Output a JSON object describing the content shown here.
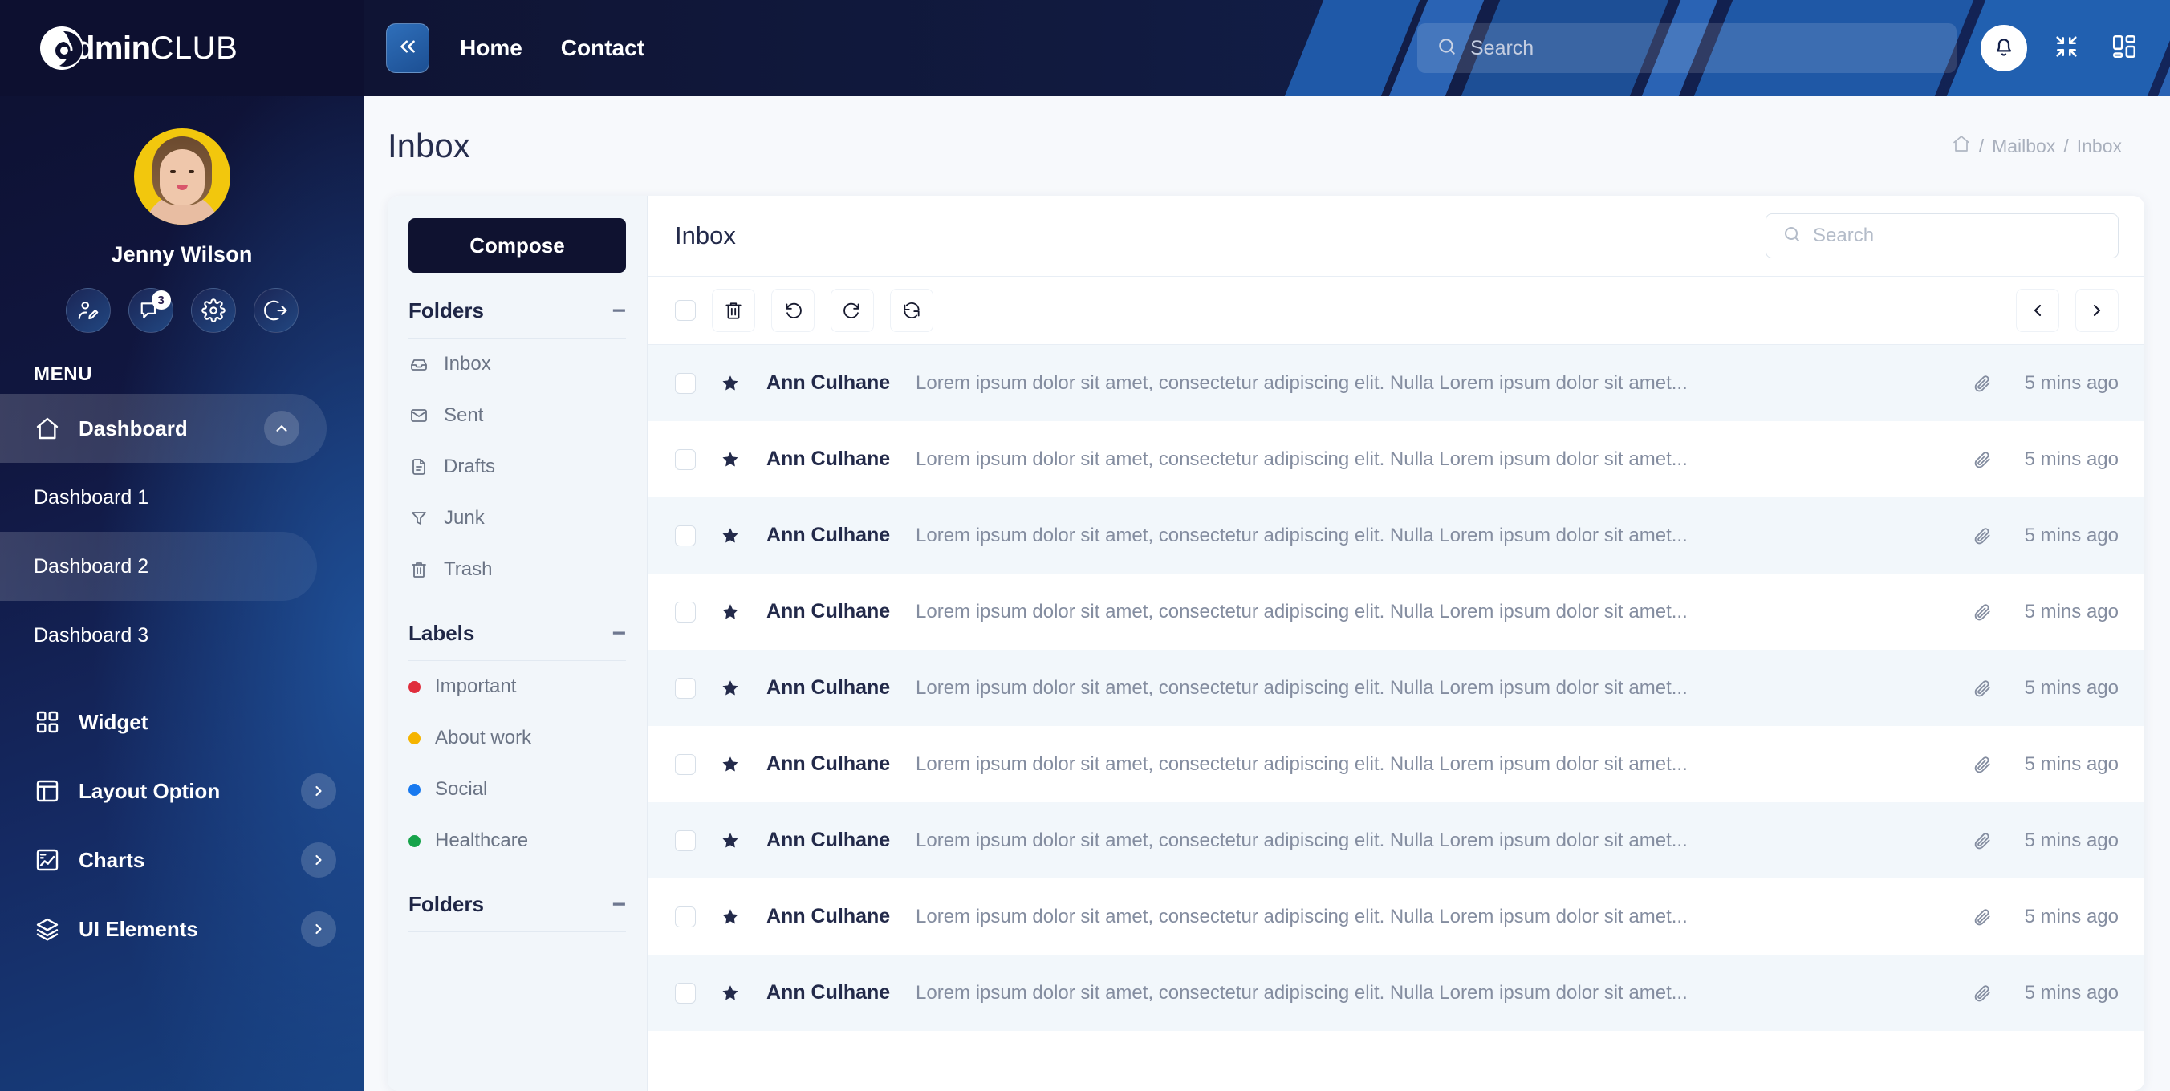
{
  "brand": {
    "name_bold": "dmin",
    "name_light": "CLUB"
  },
  "topbar": {
    "collapse_icon": "chevrons-left-icon",
    "nav": [
      {
        "label": "Home"
      },
      {
        "label": "Contact"
      }
    ],
    "search": {
      "placeholder": "Search",
      "value": "",
      "icon": "search-icon"
    },
    "icons": [
      {
        "name": "notification-bell-icon"
      },
      {
        "name": "compress-screen-icon"
      },
      {
        "name": "apps-grid-icon"
      }
    ]
  },
  "sidebar": {
    "profile": {
      "name": "Jenny Wilson",
      "avatar": "user-avatar"
    },
    "profile_actions": [
      {
        "name": "edit-profile-icon",
        "badge": ""
      },
      {
        "name": "messages-icon",
        "badge": "3"
      },
      {
        "name": "settings-gear-icon",
        "badge": ""
      },
      {
        "name": "logout-icon",
        "badge": ""
      }
    ],
    "menu_label": "MENU",
    "items": [
      {
        "label": "Dashboard",
        "icon": "home-icon",
        "active": true,
        "expanded": true,
        "chevron": "chevron-up-icon"
      },
      {
        "label": "Dashboard 1",
        "sub": true,
        "active": false
      },
      {
        "label": "Dashboard 2",
        "sub": true,
        "active": true
      },
      {
        "label": "Dashboard 3",
        "sub": true,
        "active": false
      },
      {
        "label": "Widget",
        "icon": "widget-grid-icon",
        "active": false
      },
      {
        "label": "Layout Option",
        "icon": "layout-icon",
        "active": false,
        "chevron": "chevron-right-icon"
      },
      {
        "label": "Charts",
        "icon": "charts-icon",
        "active": false,
        "chevron": "chevron-right-icon"
      },
      {
        "label": "UI Elements",
        "icon": "layers-icon",
        "active": false,
        "chevron": "chevron-right-icon"
      }
    ]
  },
  "page": {
    "title": "Inbox",
    "breadcrumb": {
      "home_icon": "home-icon",
      "sep1": "/",
      "item1": "Mailbox",
      "sep2": "/",
      "item2": "Inbox"
    }
  },
  "mailbox": {
    "compose_label": "Compose",
    "sections": [
      {
        "title": "Folders",
        "collapse_icon": "minus-icon",
        "items": [
          {
            "label": "Inbox",
            "icon": "inbox-tray-icon"
          },
          {
            "label": "Sent",
            "icon": "envelope-icon"
          },
          {
            "label": "Drafts",
            "icon": "document-icon"
          },
          {
            "label": "Junk",
            "icon": "funnel-icon"
          },
          {
            "label": "Trash",
            "icon": "trash-icon"
          }
        ]
      },
      {
        "title": "Labels",
        "collapse_icon": "minus-icon",
        "items": [
          {
            "label": "Important",
            "color": "#e02d3c"
          },
          {
            "label": "About work",
            "color": "#f5b400"
          },
          {
            "label": "Social",
            "color": "#1879ef"
          },
          {
            "label": "Healthcare",
            "color": "#16a34a"
          }
        ]
      },
      {
        "title": "Folders",
        "collapse_icon": "minus-icon",
        "items": []
      }
    ]
  },
  "maillist": {
    "title": "Inbox",
    "search": {
      "placeholder": "Search",
      "value": "",
      "icon": "search-icon"
    },
    "toolbar": [
      {
        "name": "select-all-checkbox"
      },
      {
        "name": "delete-icon"
      },
      {
        "name": "undo-rotate-left-icon"
      },
      {
        "name": "redo-rotate-right-icon"
      },
      {
        "name": "refresh-icon"
      }
    ],
    "pager": [
      {
        "name": "prev-page-icon"
      },
      {
        "name": "next-page-icon"
      }
    ],
    "snippet": "Lorem ipsum dolor sit amet, consectetur adipiscing elit. Nulla Lorem ipsum dolor sit amet...",
    "rows": [
      {
        "sender": "Ann Culhane",
        "time": "5 mins ago",
        "starred": true,
        "attachment": true
      },
      {
        "sender": "Ann Culhane",
        "time": "5 mins ago",
        "starred": true,
        "attachment": true
      },
      {
        "sender": "Ann Culhane",
        "time": "5 mins ago",
        "starred": true,
        "attachment": true
      },
      {
        "sender": "Ann Culhane",
        "time": "5 mins ago",
        "starred": true,
        "attachment": true
      },
      {
        "sender": "Ann Culhane",
        "time": "5 mins ago",
        "starred": true,
        "attachment": true
      },
      {
        "sender": "Ann Culhane",
        "time": "5 mins ago",
        "starred": true,
        "attachment": true
      },
      {
        "sender": "Ann Culhane",
        "time": "5 mins ago",
        "starred": true,
        "attachment": true
      },
      {
        "sender": "Ann Culhane",
        "time": "5 mins ago",
        "starred": true,
        "attachment": true
      },
      {
        "sender": "Ann Culhane",
        "time": "5 mins ago",
        "starred": true,
        "attachment": true
      }
    ]
  },
  "colors": {
    "brand_dark": "#0d1030",
    "brand_blue": "#1c4f93",
    "accent_blue": "#2f6fba",
    "text_dark": "#232a4a",
    "text_muted": "#848da0"
  }
}
